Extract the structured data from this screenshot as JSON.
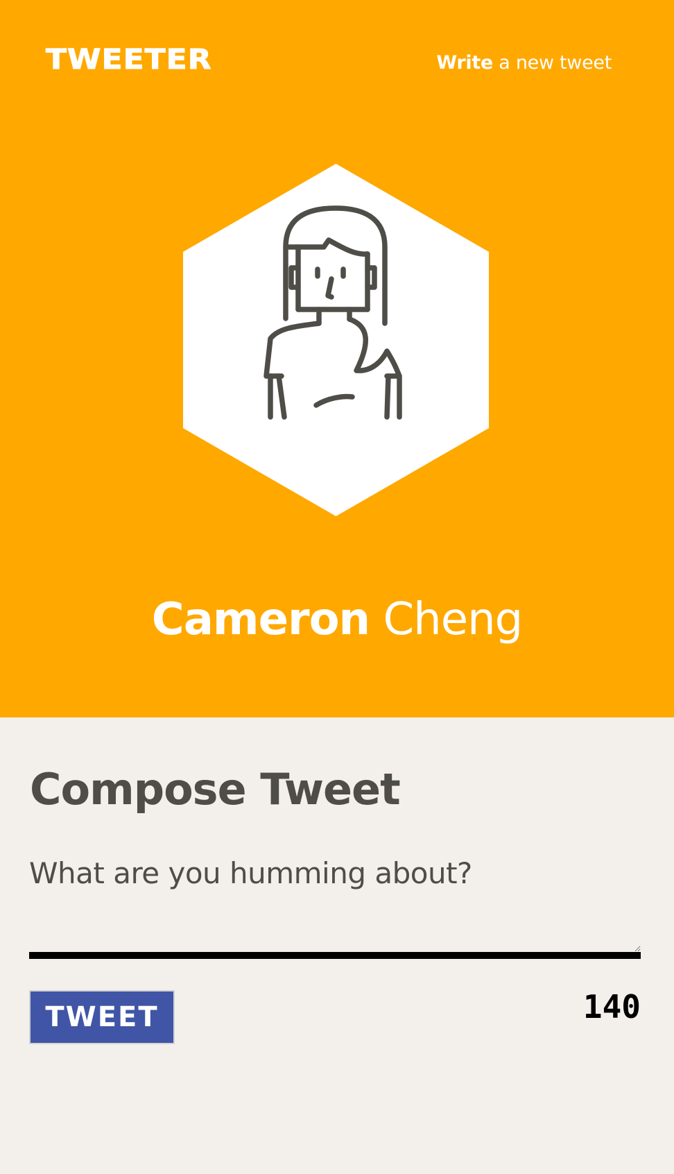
{
  "nav": {
    "brand": "TWEETER",
    "write_strong": "Write",
    "write_rest": " a new tweet"
  },
  "profile": {
    "first_name": "Cameron",
    "last_name": "Cheng",
    "avatar_icon": "woman-avatar-icon"
  },
  "compose": {
    "title": "Compose Tweet",
    "input_value": "",
    "input_placeholder": "What are you humming about?",
    "button_label": "TWEET",
    "counter": "140"
  },
  "colors": {
    "header_bg": "#ffa800",
    "page_bg": "#f3f0ec",
    "text_dark": "#4f4d47",
    "button_bg": "#4055a6"
  }
}
